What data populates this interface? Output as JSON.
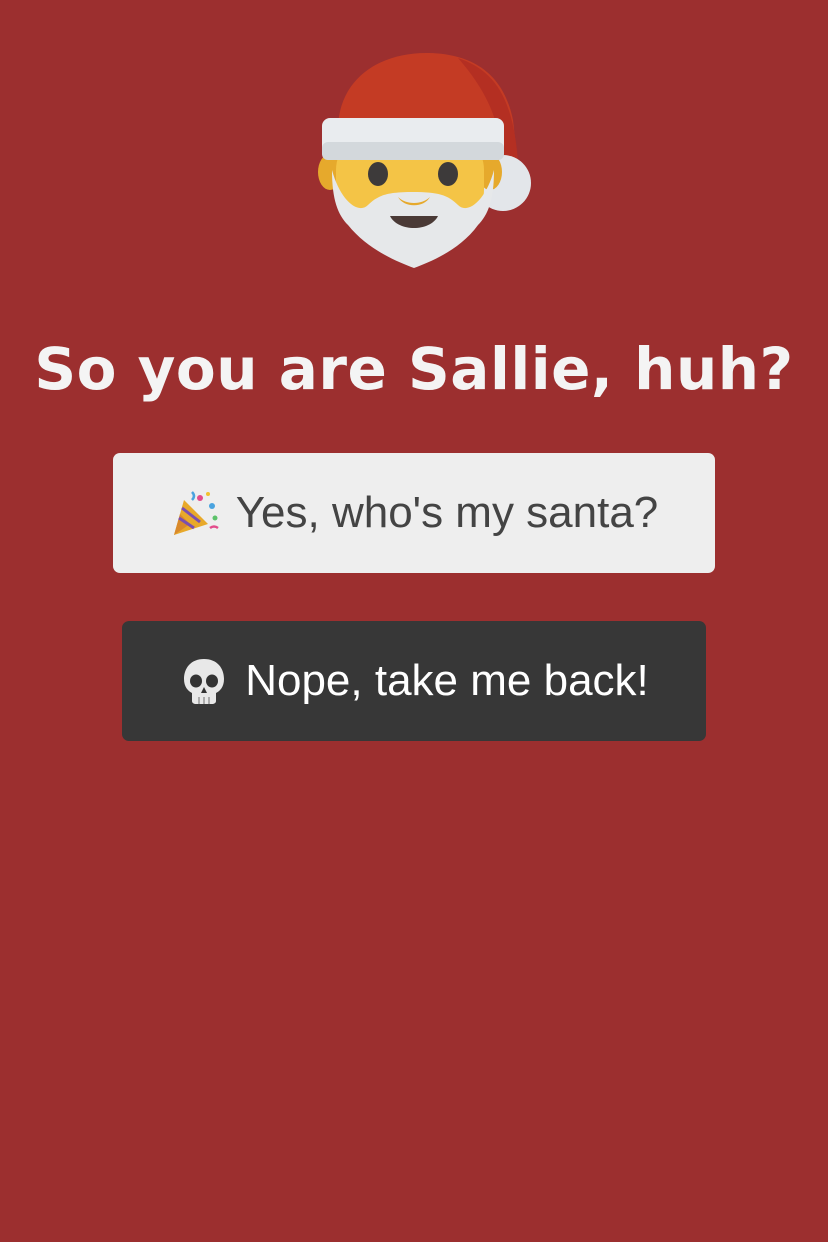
{
  "page": {
    "background_color": "#9c2f2f"
  },
  "header": {
    "avatar_icon": "santa-claus-emoji"
  },
  "title": "So you are Sallie, huh?",
  "buttons": {
    "confirm": {
      "label": "Yes, who's my santa?",
      "icon": "party-popper-icon",
      "background": "#eeeeee",
      "text_color": "#444444"
    },
    "cancel": {
      "label": "Nope, take me back!",
      "icon": "skull-icon",
      "background": "#373737",
      "text_color": "#ffffff"
    }
  }
}
